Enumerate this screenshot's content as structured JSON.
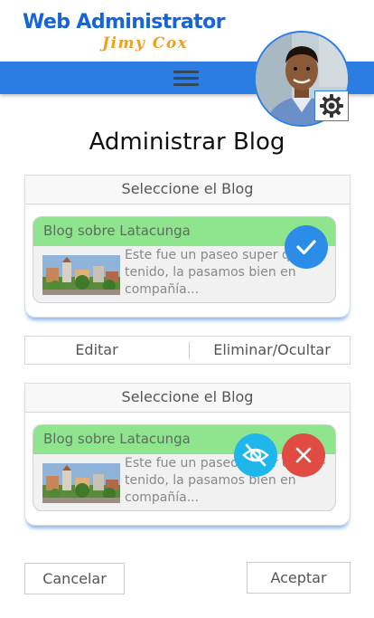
{
  "brand": {
    "title": "Web Administrator",
    "subtitle": "Jimy Cox"
  },
  "page_title": "Administrar Blog",
  "panels": [
    {
      "header": "Seleccione el Blog",
      "card": {
        "title": "Blog sobre Latacunga",
        "description": "Este fue un paseo super que di-tenido, la pasamos bien en compañía..."
      }
    },
    {
      "header": "Seleccione el Blog",
      "card": {
        "title": "Blog sobre Latacunga",
        "description": "Este fue un paseo super que di-tenido, la pasamos bien en compañía..."
      }
    }
  ],
  "tabs": [
    {
      "label": "Editar"
    },
    {
      "label": "Eliminar/Ocultar"
    }
  ],
  "footer": {
    "cancel_label": "Cancelar",
    "accept_label": "Aceptar"
  },
  "icons": {
    "menu": "hamburger-icon",
    "settings": "gear-icon",
    "select": "check-icon",
    "hide": "eye-off-icon",
    "delete": "close-icon"
  },
  "colors": {
    "primary": "#2b7de3",
    "brand_title": "#1565d8",
    "brand_sub": "#f0a020",
    "card_header": "#8ee58e",
    "hide_button": "#1fb6ec",
    "delete_button": "#e04b43"
  }
}
